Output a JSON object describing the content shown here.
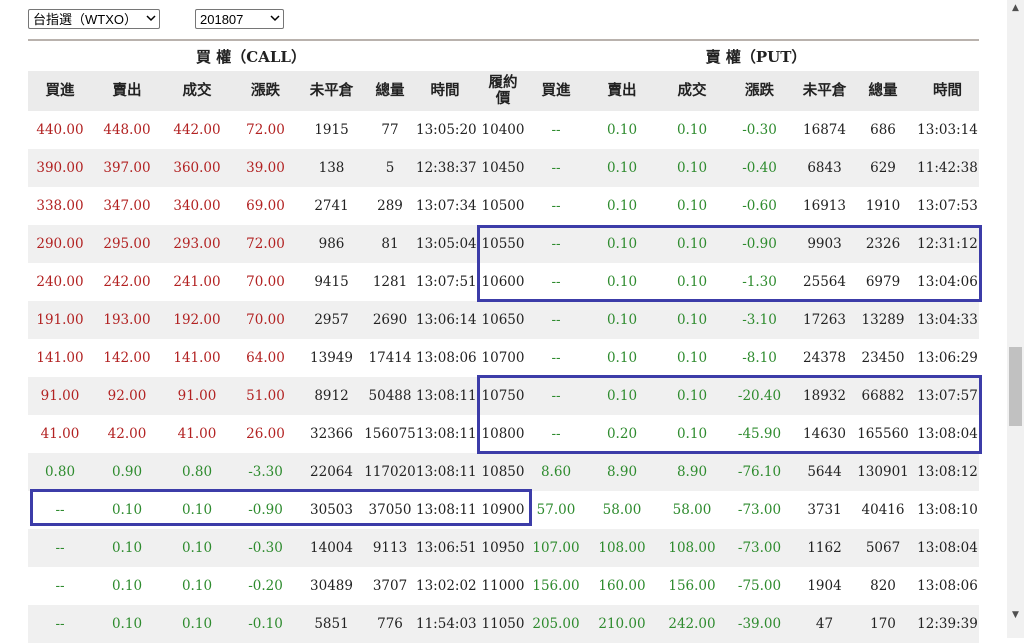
{
  "selects": {
    "product": "台指選（WTXO）",
    "month": "201807"
  },
  "groups": {
    "call": "買 權（CALL）",
    "put": "賣 權（PUT）"
  },
  "headers": [
    "買進",
    "賣出",
    "成交",
    "漲跌",
    "未平倉",
    "總量",
    "時間",
    "履約價",
    "買進",
    "賣出",
    "成交",
    "漲跌",
    "未平倉",
    "總量",
    "時間"
  ],
  "rows": [
    {
      "call": [
        "440.00",
        "448.00",
        "442.00",
        "72.00",
        "1915",
        "77",
        "13:05:20"
      ],
      "strike": "10400",
      "put": [
        "--",
        "0.10",
        "0.10",
        "-0.30",
        "16874",
        "686",
        "13:03:14"
      ]
    },
    {
      "call": [
        "390.00",
        "397.00",
        "360.00",
        "39.00",
        "138",
        "5",
        "12:38:37"
      ],
      "strike": "10450",
      "put": [
        "--",
        "0.10",
        "0.10",
        "-0.40",
        "6843",
        "629",
        "11:42:38"
      ]
    },
    {
      "call": [
        "338.00",
        "347.00",
        "340.00",
        "69.00",
        "2741",
        "289",
        "13:07:34"
      ],
      "strike": "10500",
      "put": [
        "--",
        "0.10",
        "0.10",
        "-0.60",
        "16913",
        "1910",
        "13:07:53"
      ]
    },
    {
      "call": [
        "290.00",
        "295.00",
        "293.00",
        "72.00",
        "986",
        "81",
        "13:05:04"
      ],
      "strike": "10550",
      "put": [
        "--",
        "0.10",
        "0.10",
        "-0.90",
        "9903",
        "2326",
        "12:31:12"
      ]
    },
    {
      "call": [
        "240.00",
        "242.00",
        "241.00",
        "70.00",
        "9415",
        "1281",
        "13:07:51"
      ],
      "strike": "10600",
      "put": [
        "--",
        "0.10",
        "0.10",
        "-1.30",
        "25564",
        "6979",
        "13:04:06"
      ]
    },
    {
      "call": [
        "191.00",
        "193.00",
        "192.00",
        "70.00",
        "2957",
        "2690",
        "13:06:14"
      ],
      "strike": "10650",
      "put": [
        "--",
        "0.10",
        "0.10",
        "-3.10",
        "17263",
        "13289",
        "13:04:33"
      ]
    },
    {
      "call": [
        "141.00",
        "142.00",
        "141.00",
        "64.00",
        "13949",
        "17414",
        "13:08:06"
      ],
      "strike": "10700",
      "put": [
        "--",
        "0.10",
        "0.10",
        "-8.10",
        "24378",
        "23450",
        "13:06:29"
      ]
    },
    {
      "call": [
        "91.00",
        "92.00",
        "91.00",
        "51.00",
        "8912",
        "50488",
        "13:08:11"
      ],
      "strike": "10750",
      "put": [
        "--",
        "0.10",
        "0.10",
        "-20.40",
        "18932",
        "66882",
        "13:07:57"
      ]
    },
    {
      "call": [
        "41.00",
        "42.00",
        "41.00",
        "26.00",
        "32366",
        "156075",
        "13:08:11"
      ],
      "strike": "10800",
      "put": [
        "--",
        "0.20",
        "0.10",
        "-45.90",
        "14630",
        "165560",
        "13:08:04"
      ]
    },
    {
      "call": [
        "0.80",
        "0.90",
        "0.80",
        "-3.30",
        "22064",
        "117020",
        "13:08:11"
      ],
      "strike": "10850",
      "put": [
        "8.60",
        "8.90",
        "8.90",
        "-76.10",
        "5644",
        "130901",
        "13:08:12"
      ]
    },
    {
      "call": [
        "--",
        "0.10",
        "0.10",
        "-0.90",
        "30503",
        "37050",
        "13:08:11"
      ],
      "strike": "10900",
      "put": [
        "57.00",
        "58.00",
        "58.00",
        "-73.00",
        "3731",
        "40416",
        "13:08:10"
      ]
    },
    {
      "call": [
        "--",
        "0.10",
        "0.10",
        "-0.30",
        "14004",
        "9113",
        "13:06:51"
      ],
      "strike": "10950",
      "put": [
        "107.00",
        "108.00",
        "108.00",
        "-73.00",
        "1162",
        "5067",
        "13:08:04"
      ]
    },
    {
      "call": [
        "--",
        "0.10",
        "0.10",
        "-0.20",
        "30489",
        "3707",
        "13:02:02"
      ],
      "strike": "11000",
      "put": [
        "156.00",
        "160.00",
        "156.00",
        "-75.00",
        "1904",
        "820",
        "13:08:06"
      ]
    },
    {
      "call": [
        "--",
        "0.10",
        "0.10",
        "-0.10",
        "5851",
        "776",
        "11:54:03"
      ],
      "strike": "11050",
      "put": [
        "205.00",
        "210.00",
        "242.00",
        "-39.00",
        "47",
        "170",
        "12:39:39"
      ]
    }
  ],
  "colors": {
    "up": "#b22222",
    "down": "#2e8b2e",
    "highlight_border": "#3c3ca8",
    "header_bg": "#ebebeb"
  }
}
